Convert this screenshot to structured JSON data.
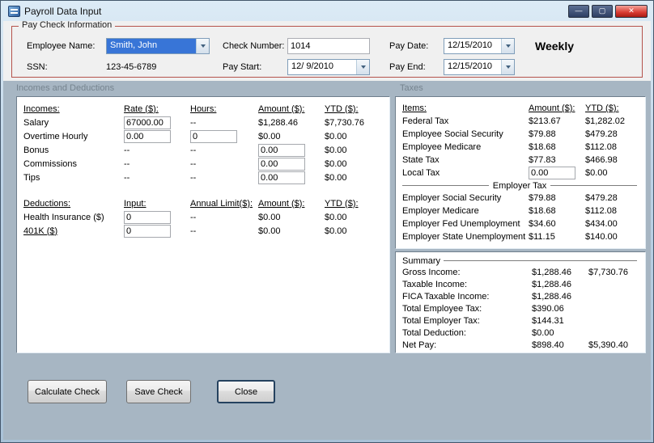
{
  "window": {
    "title": "Payroll Data Input",
    "controls": {
      "minimize": "—",
      "maximize": "▢",
      "close": "✕"
    }
  },
  "paycheck": {
    "group_title": "Pay Check Information",
    "frequency": "Weekly",
    "fields": {
      "employee_name": {
        "label": "Employee Name:",
        "value": "Smith, John"
      },
      "ssn": {
        "label": "SSN:",
        "value": "123-45-6789"
      },
      "check_number": {
        "label": "Check Number:",
        "value": "1014"
      },
      "pay_start": {
        "label": "Pay Start:",
        "value": "12/ 9/2010"
      },
      "pay_date": {
        "label": "Pay Date:",
        "value": "12/15/2010"
      },
      "pay_end": {
        "label": "Pay End:",
        "value": "12/15/2010"
      }
    }
  },
  "sections": {
    "incomes_deductions": "Incomes and Deductions",
    "taxes": "Taxes"
  },
  "incomes": {
    "headers": {
      "name": "Incomes:",
      "rate": "Rate ($):",
      "hours": "Hours:",
      "amount": "Amount ($):",
      "ytd": "YTD ($):"
    },
    "rows": [
      {
        "label": "Salary",
        "rate": "67000.00",
        "hours": "--",
        "amount": "$1,288.46",
        "ytd": "$7,730.76"
      },
      {
        "label": "Overtime Hourly",
        "rate": "0.00",
        "hours": "0",
        "amount": "$0.00",
        "ytd": "$0.00"
      },
      {
        "label": "Bonus",
        "rate": "--",
        "hours": "--",
        "amount": "0.00",
        "ytd": "$0.00"
      },
      {
        "label": "Commissions",
        "rate": "--",
        "hours": "--",
        "amount": "0.00",
        "ytd": "$0.00"
      },
      {
        "label": "Tips",
        "rate": "--",
        "hours": "--",
        "amount": "0.00",
        "ytd": "$0.00"
      }
    ]
  },
  "deductions": {
    "headers": {
      "name": "Deductions:",
      "input": "Input:",
      "limit": "Annual Limit($):",
      "amount": "Amount ($):",
      "ytd": "YTD ($):"
    },
    "rows": [
      {
        "label": "Health Insurance  ($)",
        "input": "0",
        "limit": "--",
        "amount": "$0.00",
        "ytd": "$0.00"
      },
      {
        "label": "401K  ($)",
        "input": "0",
        "limit": "--",
        "amount": "$0.00",
        "ytd": "$0.00"
      }
    ]
  },
  "taxes": {
    "headers": {
      "name": "Items:",
      "amount": "Amount ($):",
      "ytd": "YTD ($):"
    },
    "employee_rows": [
      {
        "label": "Federal Tax",
        "amount": "$213.67",
        "ytd": "$1,282.02"
      },
      {
        "label": "Employee Social Security",
        "amount": "$79.88",
        "ytd": "$479.28"
      },
      {
        "label": "Employee Medicare",
        "amount": "$18.68",
        "ytd": "$112.08"
      },
      {
        "label": "State Tax",
        "amount": "$77.83",
        "ytd": "$466.98"
      },
      {
        "label": "Local Tax",
        "amount": "0.00",
        "ytd": "$0.00"
      }
    ],
    "employer_header": "Employer Tax",
    "employer_rows": [
      {
        "label": "Employer Social Security",
        "amount": "$79.88",
        "ytd": "$479.28"
      },
      {
        "label": "Employer Medicare",
        "amount": "$18.68",
        "ytd": "$112.08"
      },
      {
        "label": "Employer Fed Unemployment",
        "amount": "$34.60",
        "ytd": "$434.00"
      },
      {
        "label": "Employer State Unemployment",
        "amount": "$11.15",
        "ytd": "$140.00"
      }
    ]
  },
  "summary": {
    "title": "Summary",
    "rows": [
      {
        "label": "Gross Income:",
        "amount": "$1,288.46",
        "ytd": "$7,730.76"
      },
      {
        "label": "Taxable Income:",
        "amount": "$1,288.46",
        "ytd": ""
      },
      {
        "label": "FICA Taxable Income:",
        "amount": "$1,288.46",
        "ytd": ""
      },
      {
        "label": "Total Employee Tax:",
        "amount": "$390.06",
        "ytd": ""
      },
      {
        "label": "Total Employer Tax:",
        "amount": "$144.31",
        "ytd": ""
      },
      {
        "label": "Total Deduction:",
        "amount": "$0.00",
        "ytd": ""
      },
      {
        "label": "Net Pay:",
        "amount": "$898.40",
        "ytd": "$5,390.40"
      }
    ]
  },
  "buttons": {
    "calculate": "Calculate Check",
    "save": "Save Check",
    "close": "Close"
  },
  "colors": {
    "main_background": "#a7b6c3",
    "group_border": "#b5534c",
    "selection_blue": "#3875d7",
    "close_red": "#d83a31",
    "titlebar_top": "#dcebf6",
    "titlebar_bottom": "#a9c2d8"
  }
}
